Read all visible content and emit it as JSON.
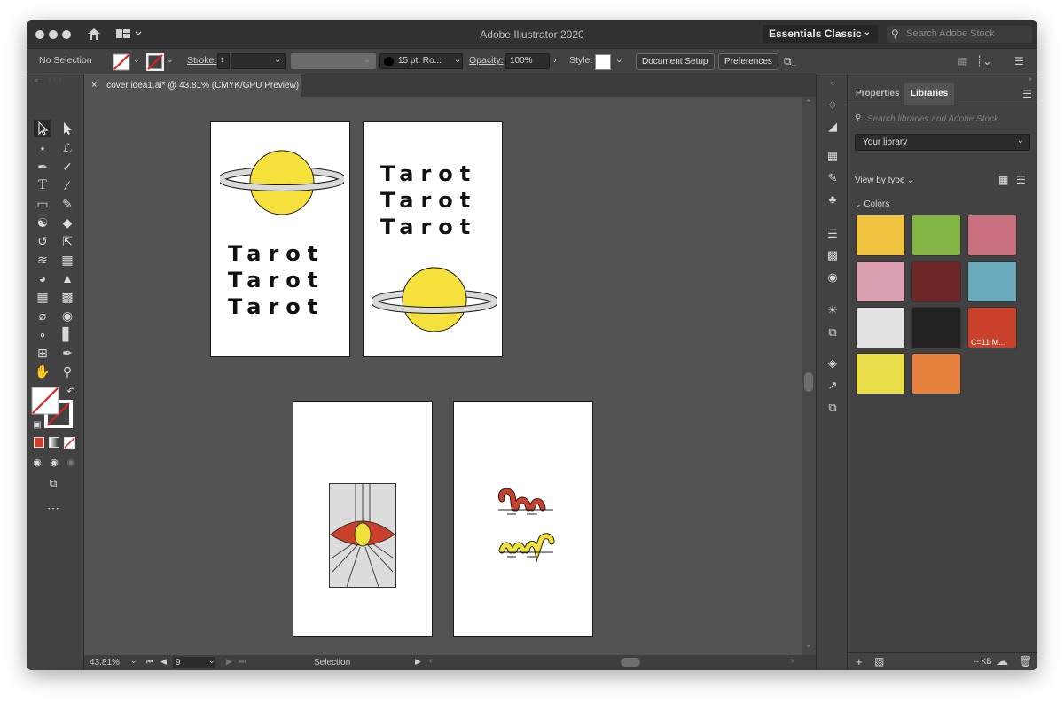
{
  "window": {
    "title": "Adobe Illustrator 2020",
    "workspace": "Essentials Classic",
    "stock_search_placeholder": "Search Adobe Stock"
  },
  "control_bar": {
    "selection_status": "No Selection",
    "stroke_label": "Stroke:",
    "brush_label": "15 pt. Ro...",
    "opacity_label": "Opacity:",
    "opacity_value": "100%",
    "style_label": "Style:",
    "document_setup": "Document Setup",
    "preferences": "Preferences"
  },
  "document_tab": {
    "label": "cover idea1.ai* @ 43.81% (CMYK/GPU Preview)",
    "close_symbol": "×"
  },
  "artboards": {
    "tarot_word": "Tarot",
    "planet_color": "#f5e03c",
    "ring_color": "#d9d9d9",
    "eye_red": "#c9412b",
    "serpent_red": "#c9412b",
    "serpent_yellow": "#f0e03a"
  },
  "status_bar": {
    "zoom": "43.81%",
    "artboard_number": "9",
    "tool_status": "Selection"
  },
  "right_panel": {
    "tabs": [
      "Properties",
      "Libraries"
    ],
    "active_tab": "Libraries",
    "search_placeholder": "Search libraries and Adobe Stock",
    "library_select": "Your library",
    "view_by": "View by type",
    "section_title": "Colors",
    "colors": [
      {
        "hex": "#f0c340",
        "label": ""
      },
      {
        "hex": "#83b545",
        "label": ""
      },
      {
        "hex": "#c9707e",
        "label": ""
      },
      {
        "hex": "#d9a0b0",
        "label": ""
      },
      {
        "hex": "#6b2826",
        "label": ""
      },
      {
        "hex": "#6aaabb",
        "label": ""
      },
      {
        "hex": "#e2e2e2",
        "label": ""
      },
      {
        "hex": "#222222",
        "label": ""
      },
      {
        "hex": "#c9412b",
        "label": "C=11 M..."
      },
      {
        "hex": "#eadf4a",
        "label": ""
      },
      {
        "hex": "#e6813e",
        "label": ""
      }
    ],
    "footer_size": "-- KB"
  }
}
